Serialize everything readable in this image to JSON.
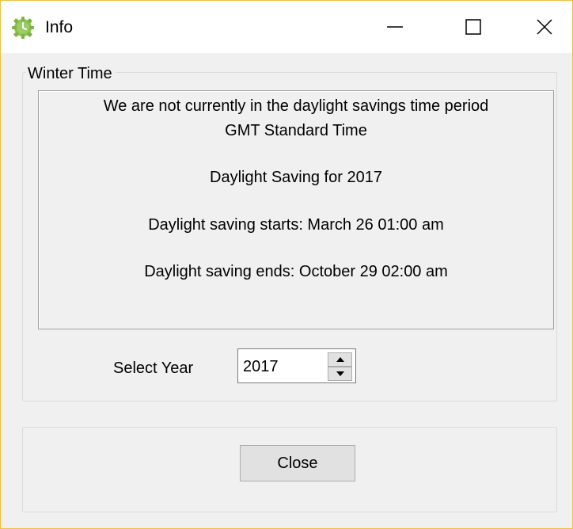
{
  "window": {
    "title": "Info",
    "icon": "clock-icon"
  },
  "titlebar_buttons": {
    "minimize": "minimize-icon",
    "maximize": "maximize-icon",
    "close": "close-icon"
  },
  "group": {
    "legend": "Winter Time"
  },
  "info": {
    "line1": "We are not currently in the daylight savings time period",
    "line2": "GMT Standard Time",
    "line3": "Daylight Saving for 2017",
    "line4": "Daylight saving starts:  March 26  01:00 am",
    "line5": "Daylight saving ends:  October 29  02:00 am"
  },
  "year_selector": {
    "label": "Select Year",
    "value": "2017"
  },
  "close_button": {
    "label": "Close"
  },
  "colors": {
    "window_border": "#f0c040",
    "dialog_bg": "#f0f0f0",
    "titlebar_bg": "#ffffff",
    "icon_green": "#8bc34a"
  }
}
